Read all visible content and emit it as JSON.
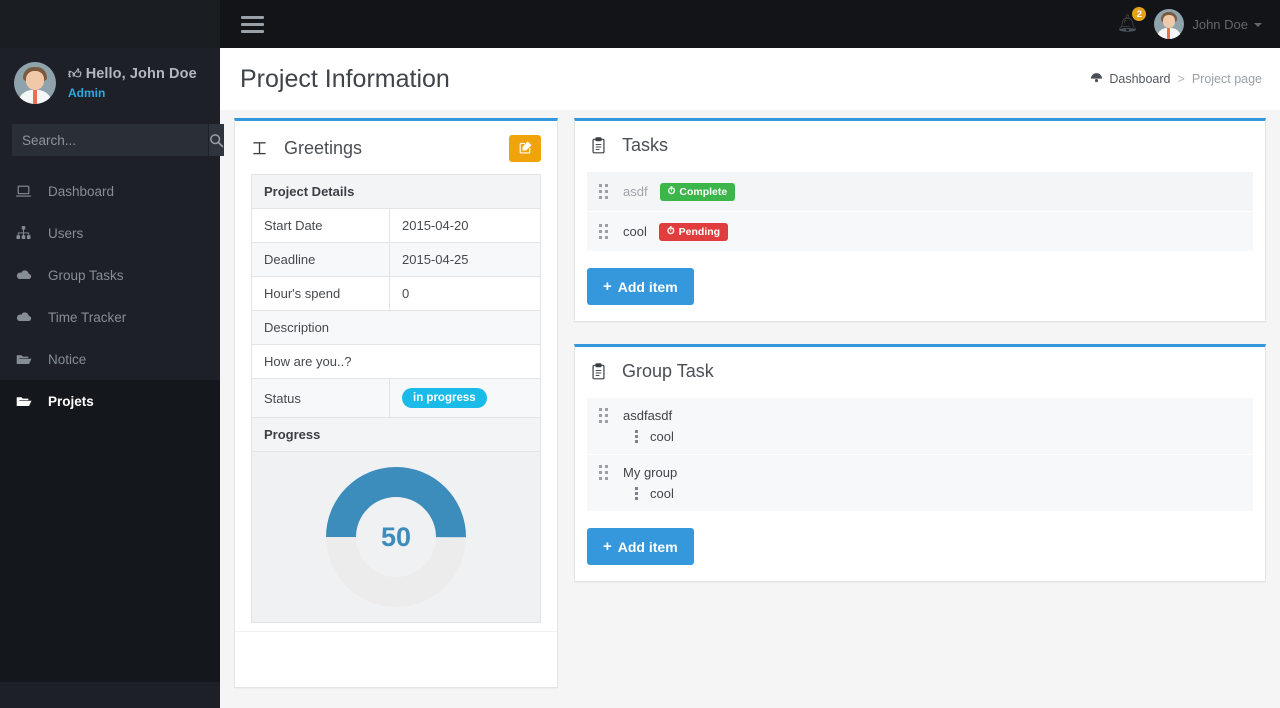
{
  "sidebar": {
    "greeting_prefix_icon": "thumbs-up-icon",
    "greeting": "Hello, John Doe",
    "role": "Admin",
    "search": {
      "placeholder": "Search...",
      "value": "",
      "button_icon": "search-icon"
    },
    "items": [
      {
        "label": "Dashboard",
        "icon": "laptop-icon",
        "active": false
      },
      {
        "label": "Users",
        "icon": "sitemap-icon",
        "active": false
      },
      {
        "label": "Group Tasks",
        "icon": "cloud-icon",
        "active": false
      },
      {
        "label": "Time Tracker",
        "icon": "cloud-icon",
        "active": false
      },
      {
        "label": "Notice",
        "icon": "folder-open-icon",
        "active": false
      },
      {
        "label": "Projets",
        "icon": "folder-open-icon",
        "active": true
      }
    ]
  },
  "topbar": {
    "menu_toggle_icon": "hamburger-icon",
    "bell_icon": "bell-icon",
    "notification_count": "2",
    "user_name": "John Doe",
    "user_caret_icon": "chevron-down-icon",
    "avatar": "avatar"
  },
  "pagehead": {
    "title": "Project Information",
    "breadcrumb": {
      "home_icon": "dashboard-icon",
      "home": "Dashboard",
      "separator": ">",
      "current": "Project page"
    }
  },
  "greetings": {
    "icon": "text-height-icon",
    "title": "Greetings",
    "edit_button_icon": "edit-square-icon",
    "table": {
      "header": "Project Details",
      "rows": [
        {
          "label": "Start Date",
          "value": "2015-04-20"
        },
        {
          "label": "Deadline",
          "value": "2015-04-25"
        },
        {
          "label": "Hour's spend",
          "value": "0"
        }
      ],
      "description_header": "Description",
      "description_text": "How are you..?",
      "status_label": "Status",
      "status_value": "in progress",
      "progress_header": "Progress"
    }
  },
  "chart_data": {
    "type": "pie",
    "title": "Progress",
    "value": 50,
    "max": 100,
    "center_label": "50",
    "fill_color": "#3c8dbc",
    "track_color": "#ececec",
    "start_angle_deg": 0,
    "direction": "clockwise"
  },
  "tasks_panel": {
    "icon": "clipboard-icon",
    "title": "Tasks",
    "items": [
      {
        "handle_icon": "drag-handle-icon",
        "name": "asdf",
        "badge": "Complete",
        "badge_icon": "clock-icon",
        "badge_color": "#3cb54b",
        "completed": true
      },
      {
        "handle_icon": "drag-handle-icon",
        "name": "cool",
        "badge": "Pending",
        "badge_icon": "clock-icon",
        "badge_color": "#e03e3e",
        "completed": false
      }
    ],
    "add_button": {
      "icon": "plus-icon",
      "label": "Add item"
    }
  },
  "group_task_panel": {
    "icon": "clipboard-icon",
    "title": "Group Task",
    "groups": [
      {
        "handle_icon": "drag-handle-icon",
        "name": "asdfasdf",
        "sub_handle_icon": "vertical-dots-icon",
        "sub_item": "cool"
      },
      {
        "handle_icon": "drag-handle-icon",
        "name": "My group",
        "sub_handle_icon": "vertical-dots-icon",
        "sub_item": "cool"
      }
    ],
    "add_button": {
      "icon": "plus-icon",
      "label": "Add item"
    }
  },
  "colors": {
    "accent_blue": "#3598dc",
    "sidebar_bg": "#1d2127",
    "role_blue": "#2daae1",
    "edit_orange": "#f0a30a",
    "status_cyan": "#1bbbe9",
    "badge_green": "#3cb54b",
    "badge_red": "#e03e3e",
    "notify_orange": "#e3a21a"
  }
}
